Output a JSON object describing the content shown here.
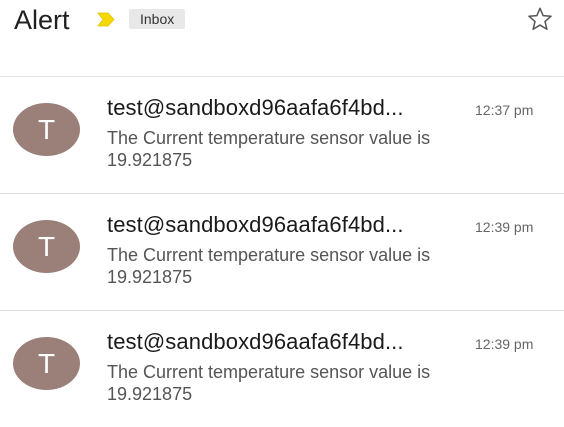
{
  "header": {
    "title": "Alert",
    "label": "Inbox",
    "importance_icon": "importance-marker-icon",
    "importance_color": "#f5d800",
    "star_icon": "star-outline-icon"
  },
  "messages": [
    {
      "avatar_letter": "T",
      "sender": "test@sandboxd96aafa6f4bd...",
      "time": "12:37 pm",
      "snippet_line1": "The Current temperature sensor value is",
      "snippet_line2": "19.921875"
    },
    {
      "avatar_letter": "T",
      "sender": "test@sandboxd96aafa6f4bd...",
      "time": "12:39 pm",
      "snippet_line1": "The Current temperature sensor value is",
      "snippet_line2": "19.921875"
    },
    {
      "avatar_letter": "T",
      "sender": "test@sandboxd96aafa6f4bd...",
      "time": "12:39 pm",
      "snippet_line1": "The Current temperature sensor value is",
      "snippet_line2": "19.921875"
    }
  ],
  "colors": {
    "avatar": "#9b8079",
    "divider": "#e2e2e2"
  }
}
